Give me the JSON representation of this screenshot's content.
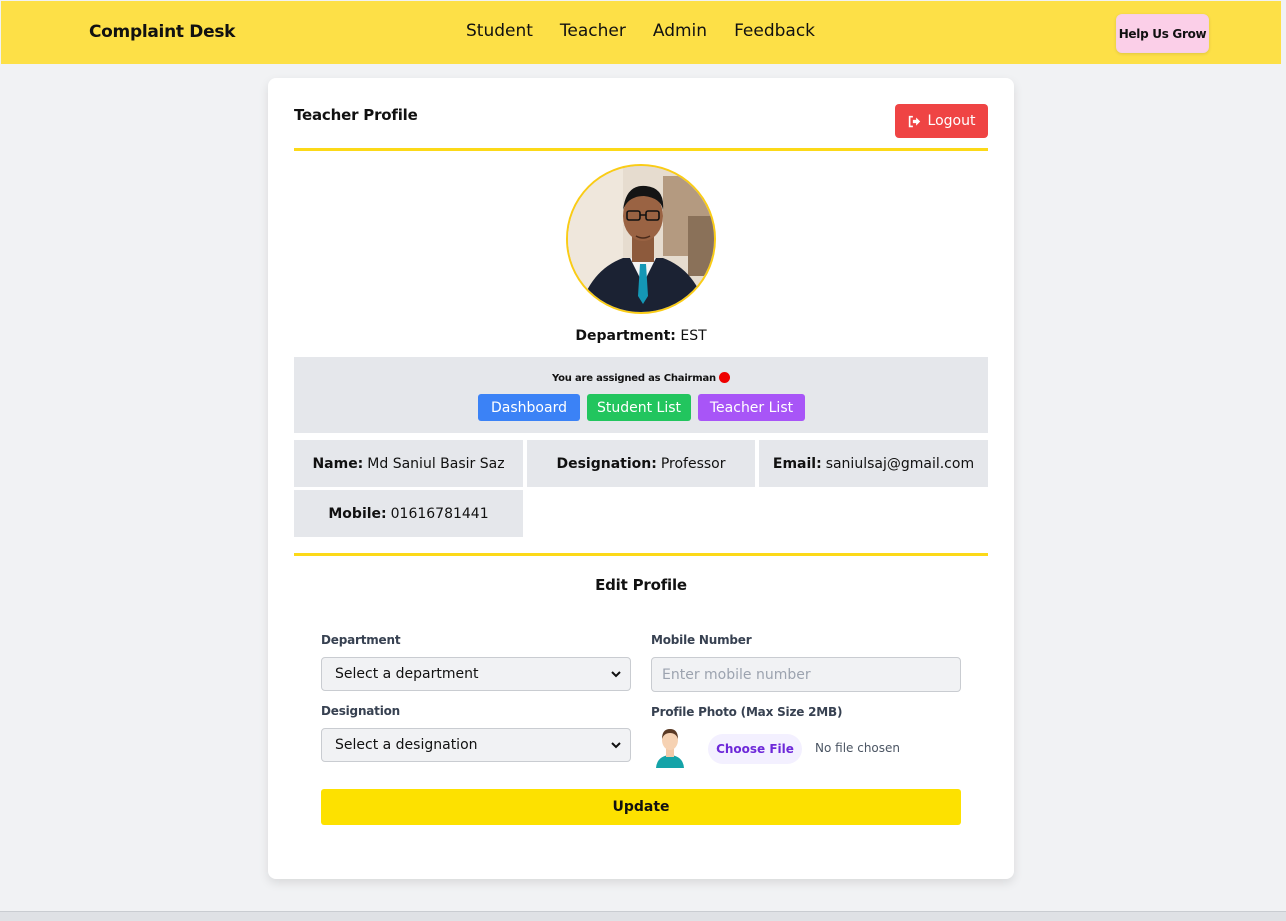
{
  "navbar": {
    "brand": "Complaint Desk",
    "links": [
      "Student",
      "Teacher",
      "Admin",
      "Feedback"
    ],
    "help_button": "Help Us Grow"
  },
  "profile": {
    "title": "Teacher Profile",
    "logout_label": "Logout",
    "department_label": "Department:",
    "department_value": "EST",
    "chairman_text": "You are assigned as Chairman",
    "chair_buttons": [
      "Dashboard",
      "Student List",
      "Teacher List"
    ],
    "info": {
      "name_label": "Name:",
      "name_value": "Md Saniul Basir Saz",
      "designation_label": "Designation:",
      "designation_value": "Professor",
      "email_label": "Email:",
      "email_value": "saniulsaj@gmail.com",
      "mobile_label": "Mobile:",
      "mobile_value": "01616781441"
    }
  },
  "edit": {
    "title": "Edit Profile",
    "department_label": "Department",
    "department_select": "Select a department",
    "mobile_label": "Mobile Number",
    "mobile_placeholder": "Enter mobile number",
    "designation_label": "Designation",
    "designation_select": "Select a designation",
    "photo_label": "Profile Photo (Max Size 2MB)",
    "choose_file": "Choose File",
    "no_file": "No file chosen",
    "update_label": "Update"
  },
  "colors": {
    "accent_yellow": "#fde047",
    "logout_red": "#ef4444",
    "dashboard_blue": "#3b82f6",
    "student_green": "#22c55e",
    "teacher_purple": "#a855f7"
  }
}
